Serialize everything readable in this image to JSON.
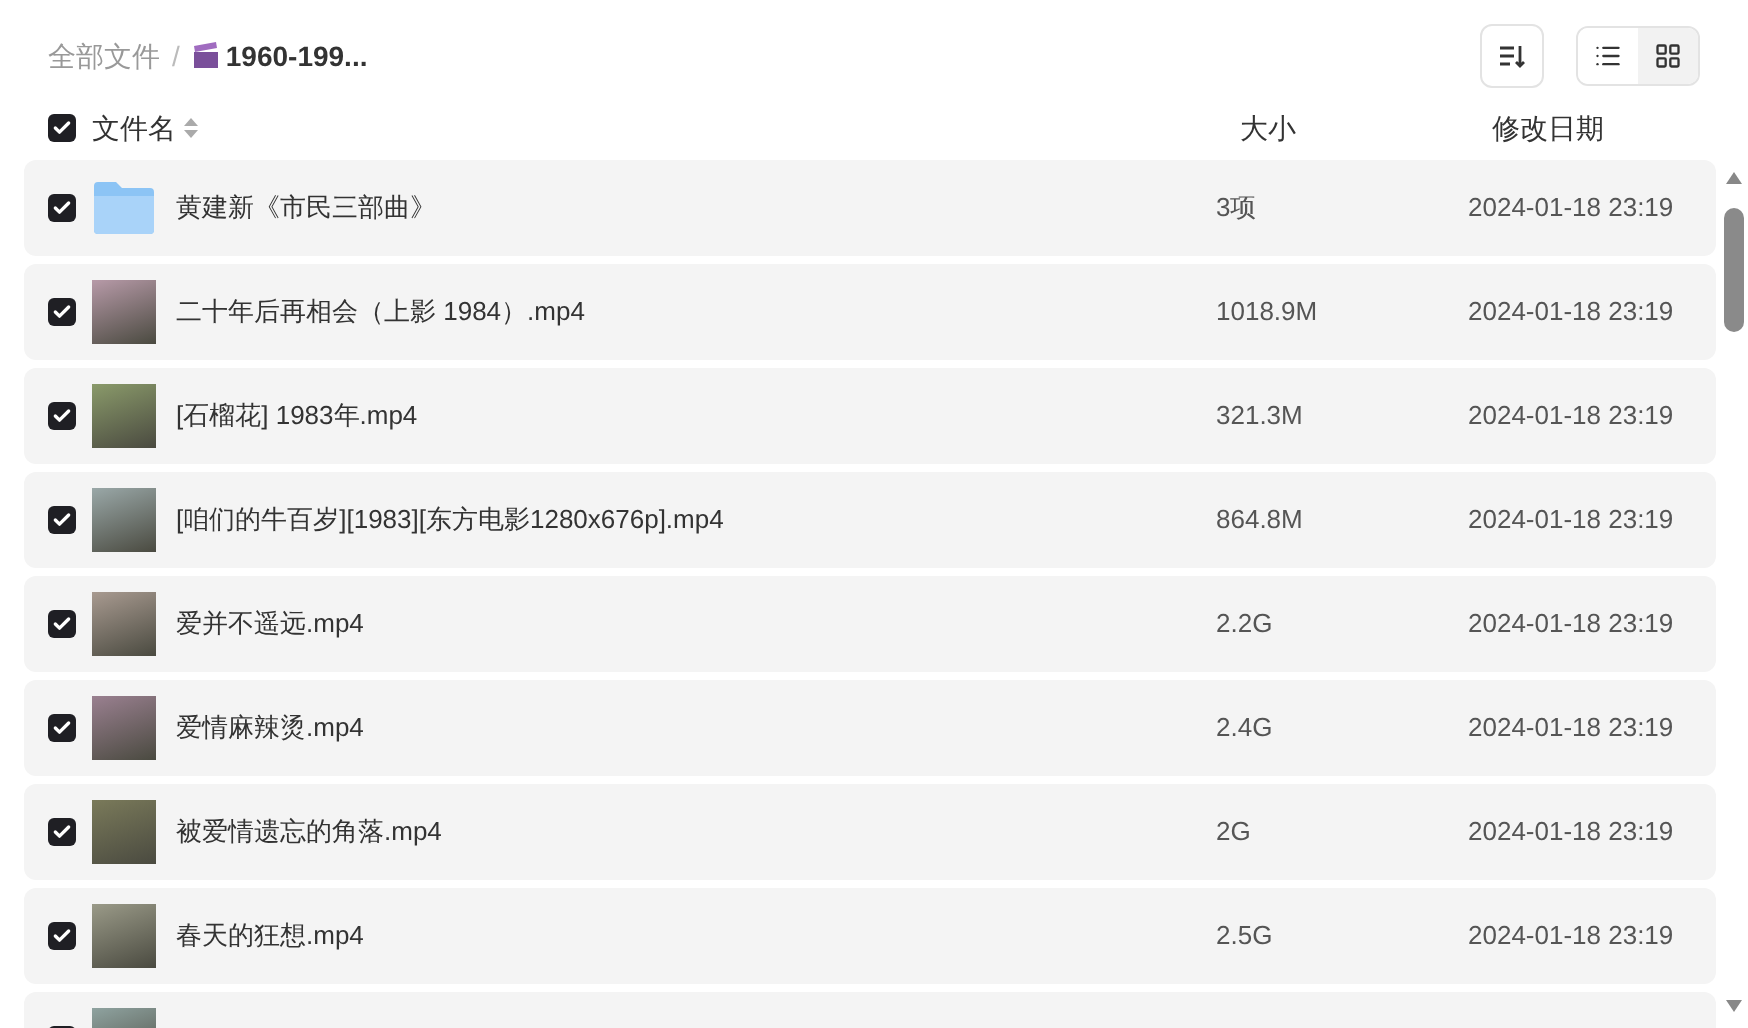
{
  "breadcrumb": {
    "root": "全部文件",
    "separator": "/",
    "current": "1960-199..."
  },
  "view_modes": [
    {
      "kind": "list",
      "selected": true
    },
    {
      "kind": "grid",
      "selected": false
    }
  ],
  "header": {
    "all_checked": true,
    "name": "文件名",
    "size": "大小",
    "modified": "修改日期"
  },
  "rows": [
    {
      "kind": "folder",
      "checked": true,
      "name": "黄建新《市民三部曲》",
      "size": "3项",
      "modified": "2024-01-18 23:19"
    },
    {
      "kind": "video",
      "checked": true,
      "name": "二十年后再相会（上影 1984）.mp4",
      "size": "1018.9M",
      "modified": "2024-01-18 23:19"
    },
    {
      "kind": "video",
      "checked": true,
      "name": "[石榴花] 1983年.mp4",
      "size": "321.3M",
      "modified": "2024-01-18 23:19"
    },
    {
      "kind": "video",
      "checked": true,
      "name": "[咱们的牛百岁][1983][东方电影1280x676p].mp4",
      "size": "864.8M",
      "modified": "2024-01-18 23:19"
    },
    {
      "kind": "video",
      "checked": true,
      "name": "爱并不遥远.mp4",
      "size": "2.2G",
      "modified": "2024-01-18 23:19"
    },
    {
      "kind": "video",
      "checked": true,
      "name": "爱情麻辣烫.mp4",
      "size": "2.4G",
      "modified": "2024-01-18 23:19"
    },
    {
      "kind": "video",
      "checked": true,
      "name": "被爱情遗忘的角落.mp4",
      "size": "2G",
      "modified": "2024-01-18 23:19"
    },
    {
      "kind": "video",
      "checked": true,
      "name": "春天的狂想.mp4",
      "size": "2.5G",
      "modified": "2024-01-18 23:19"
    },
    {
      "kind": "video",
      "checked": true
    }
  ]
}
